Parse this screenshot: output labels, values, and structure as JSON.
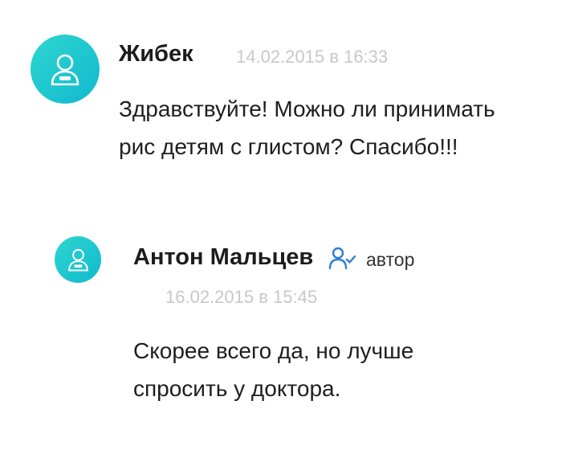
{
  "comments": [
    {
      "author": "Жибек",
      "date": "14.02.2015 в 16:33",
      "text_lines": [
        "Здравствуйте! Можно ли принимать",
        "рис детям с глистом? Спасибо!!!"
      ],
      "avatar_icon": "user-icon"
    },
    {
      "author": "Антон Мальцев",
      "badge": "автор",
      "badge_icon": "author-check-icon",
      "date": "16.02.2015 в 15:45",
      "text_lines": [
        "Скорее всего да, но лучше",
        "спросить у доктора."
      ],
      "avatar_icon": "user-icon"
    }
  ],
  "colors": {
    "avatar_gradient_start": "#2fd6cf",
    "avatar_gradient_end": "#10b9cf",
    "date_gray": "#c8c8c8",
    "badge_icon_blue": "#2f7fd8"
  }
}
